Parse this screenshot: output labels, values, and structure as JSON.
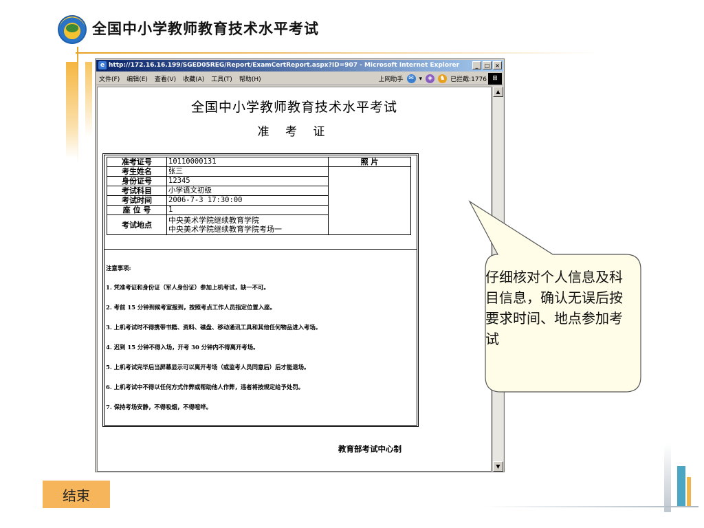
{
  "slide": {
    "title": "全国中小学教师教育技术水平考试",
    "end_label": "结束"
  },
  "browser": {
    "title": "http://172.16.16.199/SGED05REG/Report/ExamCertReport.aspx?ID=907 - Microsoft Internet Explorer",
    "menu": [
      "文件(F)",
      "编辑(E)",
      "查看(V)",
      "收藏(A)",
      "工具(T)",
      "帮助(H)"
    ],
    "toolbar": {
      "assistant": "上网助手",
      "blocked": "已拦截:1776"
    }
  },
  "document": {
    "title": "全国中小学教师教育技术水平考试",
    "subtitle": "准 考 证",
    "photo_header": "照 片",
    "rows": [
      {
        "label": "准考证号",
        "value": "10110000131"
      },
      {
        "label": "考生姓名",
        "value": "张三"
      },
      {
        "label": "身份证号",
        "value": "12345"
      },
      {
        "label": "考试科目",
        "value": "小学语文初级"
      },
      {
        "label": "考试时间",
        "value": "2006-7-3 17:30:00"
      },
      {
        "label": "座 位 号",
        "value": "1"
      }
    ],
    "location": {
      "label": "考试地点",
      "line1": "中央美术学院继续教育学院",
      "line2": "中央美术学院继续教育学院考场一"
    },
    "notes_title": "注意事项:",
    "notes": [
      "1. 凭准考证和身份证（军人身份证）参加上机考试，缺一不可。",
      "2. 考前 15 分钟到候考室报到，按照考点工作人员指定位置入座。",
      "3. 上机考试时不得携带书籍、资料、磁盘、移动通讯工具和其他任何物品进入考场。",
      "4. 迟到 15 分钟不得入场，开考 30 分钟内不得离开考场。",
      "5. 上机考试完毕后当屏幕显示可以离开考场（或监考人员同意后）后才能退场。",
      "6. 上机考试中不得以任何方式作弊或帮助他人作弊，违者将按规定给予处罚。",
      "7. 保持考场安静，不得吸烟，不得喧哗。"
    ],
    "footer": "教育部考试中心制"
  },
  "callout": {
    "text": "仔细核对个人信息及科目信息，确认无误后按要求时间、地点参加考试"
  }
}
